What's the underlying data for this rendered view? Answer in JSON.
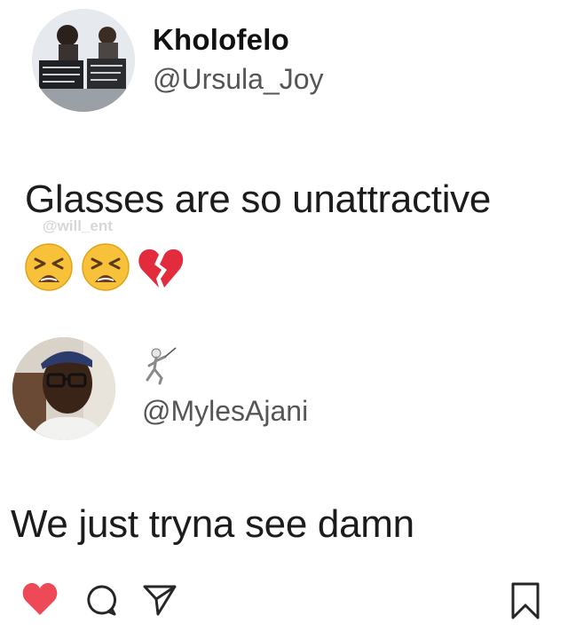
{
  "post1": {
    "display_name": "Kholofelo",
    "handle": "@Ursula_Joy",
    "text": "Glasses are so unattractive",
    "watermark": "@will_ent",
    "emojis": [
      "weary-face",
      "weary-face",
      "broken-heart"
    ]
  },
  "post2": {
    "name_emoji": "person-fencing",
    "handle": "@MylesAjani",
    "text": "We just tryna see damn"
  },
  "actions": {
    "icons": [
      "heart-icon",
      "comment-icon",
      "share-icon",
      "bookmark-icon"
    ],
    "heart_color": "#ed4956"
  }
}
